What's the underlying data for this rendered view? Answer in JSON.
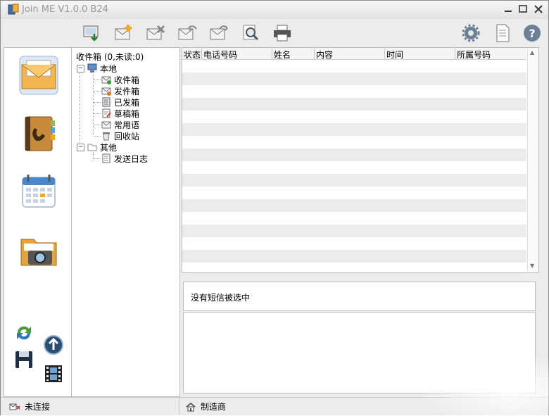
{
  "window": {
    "title": "Join ME V1.0.0 B24"
  },
  "tree": {
    "header": "收件箱 (0,未读:0)",
    "local": "本地",
    "items": [
      "收件箱",
      "发件箱",
      "已发箱",
      "草稿箱",
      "常用语",
      "回收站"
    ],
    "other": "其他",
    "other_items": [
      "发送日志"
    ]
  },
  "list": {
    "columns": [
      "状态",
      "电话号码",
      "姓名",
      "内容",
      "时间",
      "所属号码"
    ]
  },
  "preview": {
    "text": "没有短信被选中"
  },
  "status": {
    "connection": "未连接",
    "manufacturer": "制造商"
  },
  "icons": {
    "toolbar": [
      "receive-icon",
      "new-message-icon",
      "delete-message-icon",
      "reply-icon",
      "forward-icon",
      "search-icon",
      "print-icon",
      "settings-icon",
      "document-icon",
      "help-icon"
    ],
    "sidebar": [
      "messages-icon",
      "contacts-icon",
      "calendar-icon",
      "media-folder-icon",
      "sync-icon",
      "upload-icon",
      "save-icon",
      "film-icon"
    ]
  }
}
